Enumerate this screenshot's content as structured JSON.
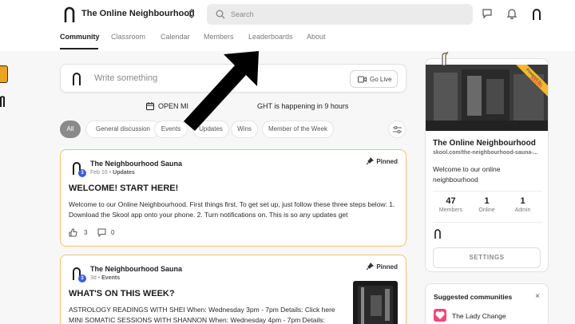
{
  "header": {
    "community_name": "The Online Neighbourhood",
    "search_placeholder": "Search"
  },
  "tabs": [
    "Community",
    "Classroom",
    "Calendar",
    "Members",
    "Leaderboards",
    "About"
  ],
  "composer": {
    "placeholder": "Write something",
    "go_live_label": "Go Live"
  },
  "event_banner": {
    "prefix": "OPEN MI",
    "suffix": "GHT is happening in 9 hours"
  },
  "filters": {
    "chips": [
      "All",
      "General discussion",
      "Events",
      "Updates",
      "Wins",
      "Member of the Week"
    ],
    "active": "All"
  },
  "posts": [
    {
      "author": "The Neighbourhood Sauna",
      "level": "3",
      "date": "Feb 16",
      "category": "Updates",
      "pinned_label": "Pinned",
      "title": "WELCOME! START HERE!",
      "body": "Welcome to our Online Neighbourhood. First things first. To get set up, just follow these three steps below: 1. Download the Skool app onto your phone. 2. Turn notifications on. This is so any updates get",
      "likes": "3",
      "comments": "0"
    },
    {
      "author": "The Neighbourhood Sauna",
      "level": "3",
      "date": "3d",
      "category": "Events",
      "pinned_label": "Pinned",
      "title": "WHAT'S ON THIS WEEK?",
      "body_line1": "ASTROLOGY READINGS WITH SHEI When: Wednesday 3pm - 7pm Details: Click here",
      "body_line2": "MINI SOMATIC SESSIONS WITH SHANNON When: Wednesday 4pm - 7pm Details:"
    }
  ],
  "sidebar": {
    "title": "The Online Neighbourhood",
    "url": "skool.com/the-neighbourhood-sauna-...",
    "description": "Welcome to our online neighbourhood",
    "ribbon_text": "Powered by skool",
    "stats": [
      {
        "value": "47",
        "label": "Members"
      },
      {
        "value": "1",
        "label": "Online"
      },
      {
        "value": "1",
        "label": "Admin"
      }
    ],
    "settings_label": "SETTINGS"
  },
  "suggested": {
    "title": "Suggested communities",
    "close": "×",
    "items": [
      {
        "name": "The Lady Change"
      }
    ]
  },
  "colors": {
    "post_border": "#f2c16d",
    "level_badge": "#3d5bd9",
    "ribbon": "#f5b82e",
    "suggest_icon": "#e94b7b"
  }
}
